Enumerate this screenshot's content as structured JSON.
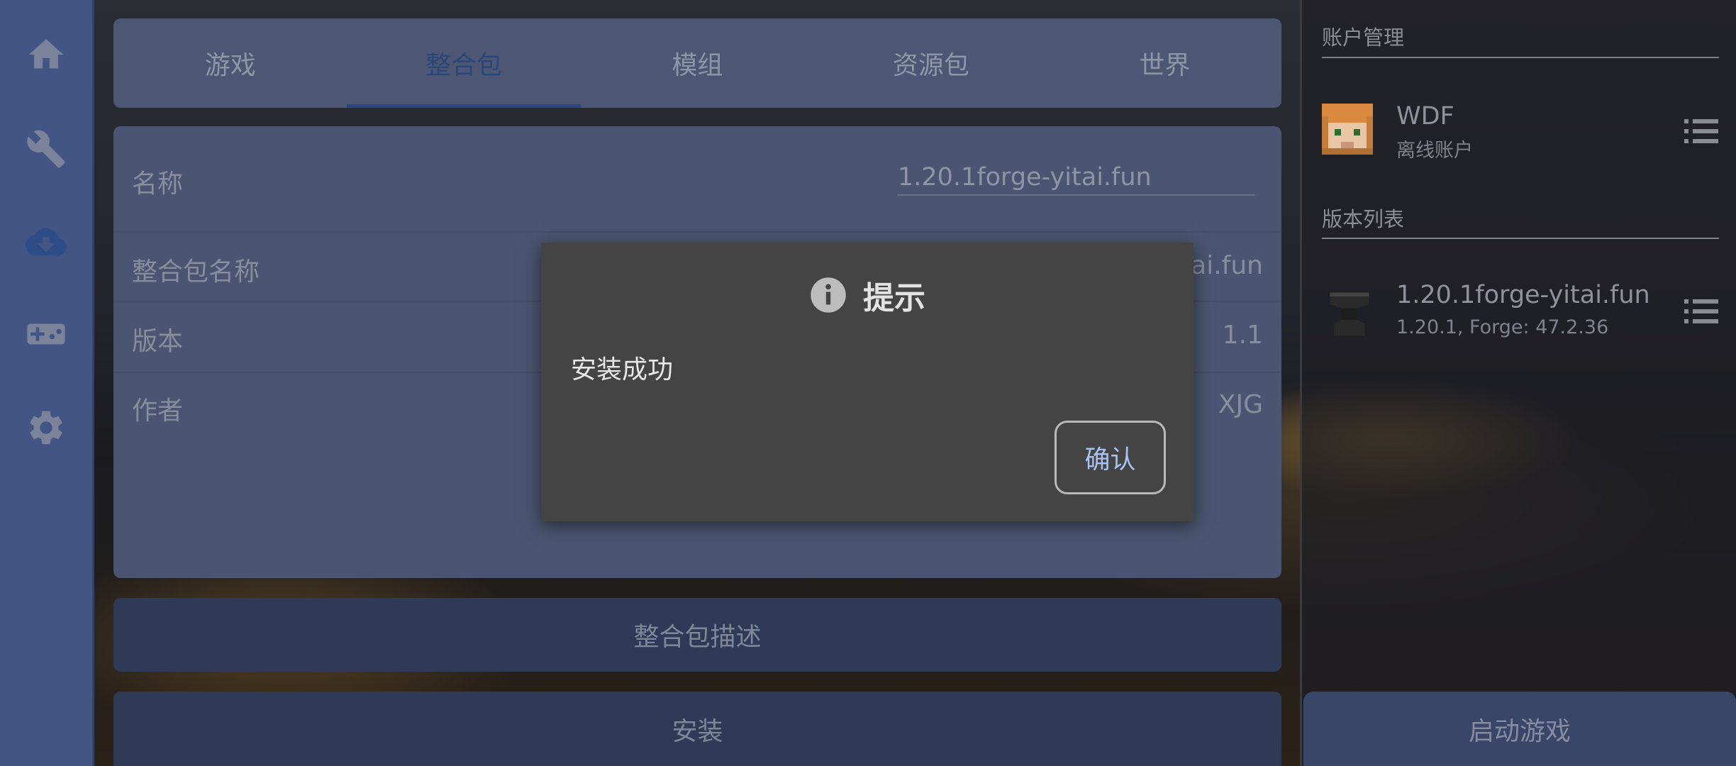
{
  "nav": {
    "items": [
      {
        "icon": "home-icon"
      },
      {
        "icon": "wrench-icon"
      },
      {
        "icon": "cloud-download-icon"
      },
      {
        "icon": "gamepad-icon"
      },
      {
        "icon": "gear-icon"
      }
    ]
  },
  "tabs": [
    {
      "label": "游戏"
    },
    {
      "label": "整合包"
    },
    {
      "label": "模组"
    },
    {
      "label": "资源包"
    },
    {
      "label": "世界"
    }
  ],
  "active_tab": "整合包",
  "info": {
    "name_label": "名称",
    "name_value": "1.20.1forge-yitai.fun",
    "modpack_name_label": "整合包名称",
    "modpack_name_value": "itai.fun",
    "version_label": "版本",
    "version_value": "1.1",
    "author_label": "作者",
    "author_value": "XJG"
  },
  "buttons": {
    "description": "整合包描述",
    "install": "安装",
    "launch": "启动游戏"
  },
  "right_panel": {
    "account_section": "账户管理",
    "account": {
      "name": "WDF",
      "type": "离线账户"
    },
    "version_section": "版本列表",
    "version": {
      "name": "1.20.1forge-yitai.fun",
      "detail": "1.20.1, Forge: 47.2.36"
    }
  },
  "dialog": {
    "title": "提示",
    "message": "安装成功",
    "confirm": "确认"
  },
  "colors": {
    "nav_bg": "#425585",
    "panel_bg": "#4d5774",
    "button_bg": "#2f3a57",
    "dialog_bg": "#444444",
    "accent": "#2a4780",
    "confirm_text": "#a8c2f2"
  }
}
